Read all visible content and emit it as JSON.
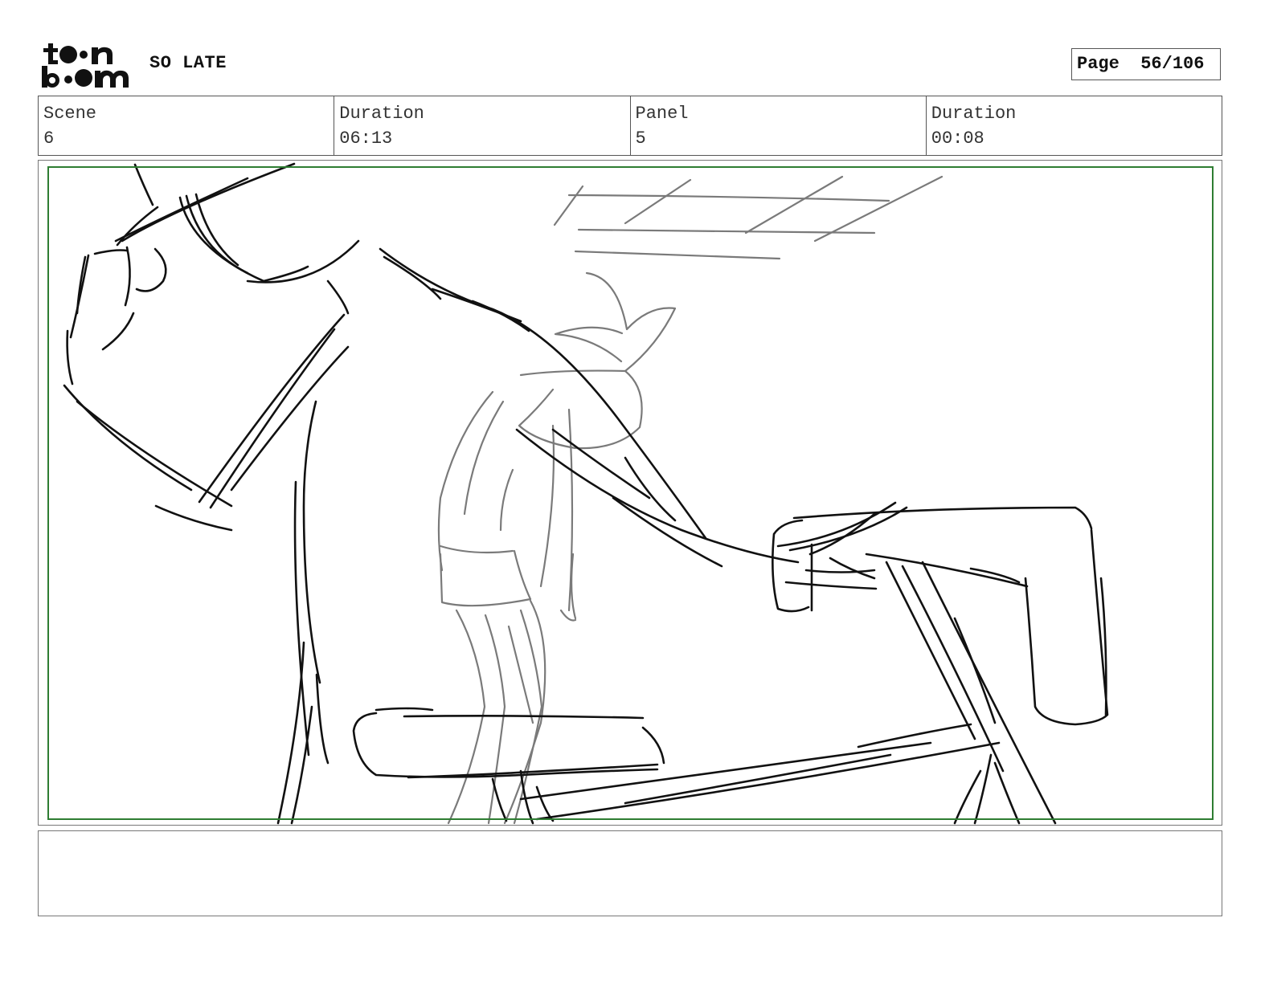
{
  "header": {
    "logo_icon": "toonboom-logo",
    "logo_line1": "t●●n",
    "logo_line2": "b●●m",
    "project_title": "SO LATE",
    "page_label": "Page",
    "page_number": "56/106"
  },
  "info": {
    "scene_label": "Scene",
    "scene_value": "6",
    "scene_duration_label": "Duration",
    "scene_duration_value": "06:13",
    "panel_label": "Panel",
    "panel_value": "5",
    "panel_duration_label": "Duration",
    "panel_duration_value": "00:08"
  },
  "panel": {
    "image_icon": "storyboard-sketch",
    "safe_frame_color": "#2e7d32",
    "ink_dark": "#111111",
    "ink_grey": "#7a7a7a"
  },
  "notes": {
    "text": ""
  }
}
